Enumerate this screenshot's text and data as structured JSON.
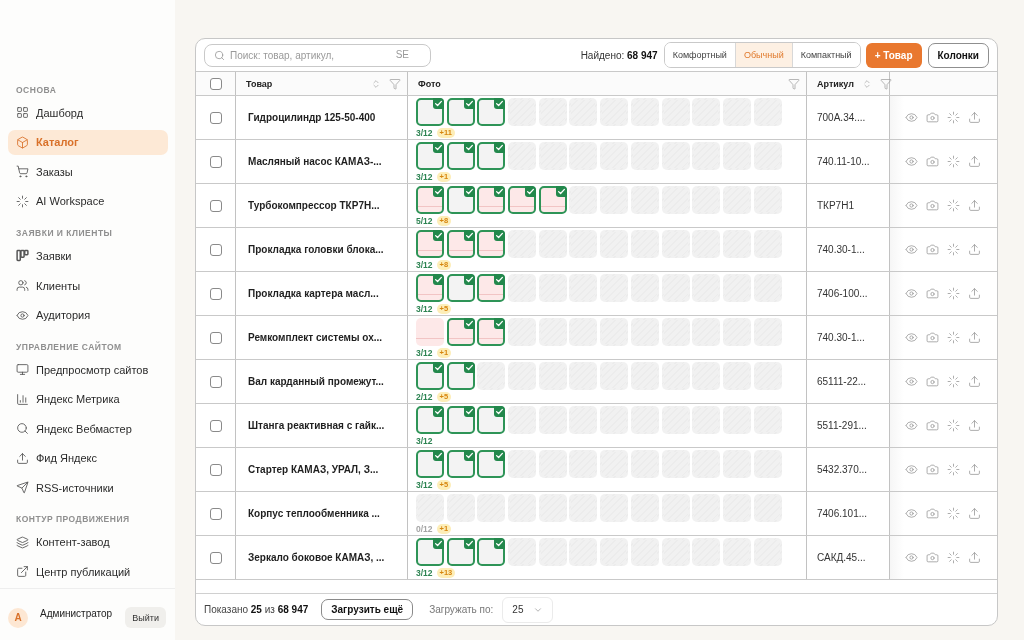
{
  "sidebar": {
    "sections": [
      {
        "label": "ОСНОВА",
        "items": [
          {
            "label": "Дашборд",
            "selected": false
          },
          {
            "label": "Каталог",
            "selected": true
          },
          {
            "label": "Заказы",
            "selected": false
          },
          {
            "label": "AI Workspace",
            "selected": false
          }
        ]
      },
      {
        "label": "ЗАЯВКИ И КЛИЕНТЫ",
        "items": [
          {
            "label": "Заявки",
            "selected": false
          },
          {
            "label": "Клиенты",
            "selected": false
          },
          {
            "label": "Аудитория",
            "selected": false
          }
        ]
      },
      {
        "label": "УПРАВЛЕНИЕ САЙТОМ",
        "items": [
          {
            "label": "Предпросмотр сайтов",
            "selected": false
          },
          {
            "label": "Яндекс Метрика",
            "selected": false
          },
          {
            "label": "Яндекс Вебмастер",
            "selected": false
          },
          {
            "label": "Фид Яндекс",
            "selected": false
          },
          {
            "label": "RSS-источники",
            "selected": false
          }
        ]
      },
      {
        "label": "КОНТУР ПРОДВИЖЕНИЯ",
        "items": [
          {
            "label": "Контент-завод",
            "selected": false
          },
          {
            "label": "Центр публикаций",
            "selected": false
          }
        ]
      }
    ],
    "user": {
      "initial": "А",
      "name": "Администратор",
      "logout": "Выйти"
    }
  },
  "toolbar": {
    "search": {
      "placeholder": "Поиск: товар, артикул,",
      "suffix": "SE"
    },
    "found": "Найдено: **68 947**",
    "density": [
      {
        "label": "Комфортный",
        "selected": false
      },
      {
        "label": "Обычный",
        "selected": true
      },
      {
        "label": "Компактный",
        "selected": false
      }
    ],
    "add_button": "+ Товар",
    "columns_button": "Колонки"
  },
  "table": {
    "header_checkbox": {
      "checked": false
    },
    "columns": [
      {
        "label": "Товар",
        "sortable": true,
        "filterable": true
      },
      {
        "label": "Фото",
        "sortable": false,
        "filterable": true
      },
      {
        "label": "Артикул",
        "sortable": true,
        "filterable": true
      }
    ],
    "rows": [
      {
        "selected": false,
        "name": "Гидроцилиндр 125-50-400",
        "photos": [
          {
            "kind": "photo",
            "checked": true
          },
          {
            "kind": "photo",
            "checked": true
          },
          {
            "kind": "photo",
            "checked": true
          },
          {
            "kind": "empty",
            "checked": false
          },
          {
            "kind": "empty",
            "checked": false
          },
          {
            "kind": "empty",
            "checked": false
          },
          {
            "kind": "empty",
            "checked": false
          },
          {
            "kind": "empty",
            "checked": false
          },
          {
            "kind": "empty",
            "checked": false
          },
          {
            "kind": "empty",
            "checked": false
          },
          {
            "kind": "empty",
            "checked": false
          },
          {
            "kind": "empty",
            "checked": false
          }
        ],
        "count": "3/12",
        "extra": "+11",
        "article": "700A.34...."
      },
      {
        "selected": false,
        "name": "Масляный насос КАМАЗ-...",
        "photos": [
          {
            "kind": "photo",
            "checked": true
          },
          {
            "kind": "photo",
            "checked": true
          },
          {
            "kind": "photo",
            "checked": true
          },
          {
            "kind": "empty",
            "checked": false
          },
          {
            "kind": "empty",
            "checked": false
          },
          {
            "kind": "empty",
            "checked": false
          },
          {
            "kind": "empty",
            "checked": false
          },
          {
            "kind": "empty",
            "checked": false
          },
          {
            "kind": "empty",
            "checked": false
          },
          {
            "kind": "empty",
            "checked": false
          },
          {
            "kind": "empty",
            "checked": false
          },
          {
            "kind": "empty",
            "checked": false
          }
        ],
        "count": "3/12",
        "extra": "+1",
        "article": "740.11-10..."
      },
      {
        "selected": false,
        "name": "Турбокомпрессор ТКР7Н...",
        "photos": [
          {
            "kind": "flagged",
            "checked": true
          },
          {
            "kind": "photo",
            "checked": true
          },
          {
            "kind": "flagged",
            "checked": true
          },
          {
            "kind": "flagged",
            "checked": true
          },
          {
            "kind": "flagged",
            "checked": true
          },
          {
            "kind": "empty",
            "checked": false
          },
          {
            "kind": "empty",
            "checked": false
          },
          {
            "kind": "empty",
            "checked": false
          },
          {
            "kind": "empty",
            "checked": false
          },
          {
            "kind": "empty",
            "checked": false
          },
          {
            "kind": "empty",
            "checked": false
          },
          {
            "kind": "empty",
            "checked": false
          }
        ],
        "count": "5/12",
        "extra": "+8",
        "article": "ТКР7Н1"
      },
      {
        "selected": false,
        "name": "Прокладка головки блока...",
        "photos": [
          {
            "kind": "flagged",
            "checked": true
          },
          {
            "kind": "flagged",
            "checked": true
          },
          {
            "kind": "flagged",
            "checked": true
          },
          {
            "kind": "empty",
            "checked": false
          },
          {
            "kind": "empty",
            "checked": false
          },
          {
            "kind": "empty",
            "checked": false
          },
          {
            "kind": "empty",
            "checked": false
          },
          {
            "kind": "empty",
            "checked": false
          },
          {
            "kind": "empty",
            "checked": false
          },
          {
            "kind": "empty",
            "checked": false
          },
          {
            "kind": "empty",
            "checked": false
          },
          {
            "kind": "empty",
            "checked": false
          }
        ],
        "count": "3/12",
        "extra": "+8",
        "article": "740.30-1..."
      },
      {
        "selected": false,
        "name": "Прокладка картера масл...",
        "photos": [
          {
            "kind": "flagged",
            "checked": true
          },
          {
            "kind": "photo",
            "checked": true
          },
          {
            "kind": "flagged",
            "checked": true
          },
          {
            "kind": "empty",
            "checked": false
          },
          {
            "kind": "empty",
            "checked": false
          },
          {
            "kind": "empty",
            "checked": false
          },
          {
            "kind": "empty",
            "checked": false
          },
          {
            "kind": "empty",
            "checked": false
          },
          {
            "kind": "empty",
            "checked": false
          },
          {
            "kind": "empty",
            "checked": false
          },
          {
            "kind": "empty",
            "checked": false
          },
          {
            "kind": "empty",
            "checked": false
          }
        ],
        "count": "3/12",
        "extra": "+5",
        "article": "7406-100..."
      },
      {
        "selected": false,
        "name": "Ремкомплект системы ох...",
        "photos": [
          {
            "kind": "flagged",
            "checked": false
          },
          {
            "kind": "flagged",
            "checked": true
          },
          {
            "kind": "flagged",
            "checked": true
          },
          {
            "kind": "empty",
            "checked": false
          },
          {
            "kind": "empty",
            "checked": false
          },
          {
            "kind": "empty",
            "checked": false
          },
          {
            "kind": "empty",
            "checked": false
          },
          {
            "kind": "empty",
            "checked": false
          },
          {
            "kind": "empty",
            "checked": false
          },
          {
            "kind": "empty",
            "checked": false
          },
          {
            "kind": "empty",
            "checked": false
          },
          {
            "kind": "empty",
            "checked": false
          }
        ],
        "count": "3/12",
        "extra": "+1",
        "article": "740.30-1..."
      },
      {
        "selected": false,
        "name": "Вал карданный промежут...",
        "photos": [
          {
            "kind": "photo",
            "checked": true
          },
          {
            "kind": "photo",
            "checked": true
          },
          {
            "kind": "empty",
            "checked": false
          },
          {
            "kind": "empty",
            "checked": false
          },
          {
            "kind": "empty",
            "checked": false
          },
          {
            "kind": "empty",
            "checked": false
          },
          {
            "kind": "empty",
            "checked": false
          },
          {
            "kind": "empty",
            "checked": false
          },
          {
            "kind": "empty",
            "checked": false
          },
          {
            "kind": "empty",
            "checked": false
          },
          {
            "kind": "empty",
            "checked": false
          },
          {
            "kind": "empty",
            "checked": false
          }
        ],
        "count": "2/12",
        "extra": "+5",
        "article": "65111-22..."
      },
      {
        "selected": false,
        "name": "Штанга реактивная с гайк...",
        "photos": [
          {
            "kind": "photo",
            "checked": true
          },
          {
            "kind": "photo",
            "checked": true
          },
          {
            "kind": "photo",
            "checked": true
          },
          {
            "kind": "empty",
            "checked": false
          },
          {
            "kind": "empty",
            "checked": false
          },
          {
            "kind": "empty",
            "checked": false
          },
          {
            "kind": "empty",
            "checked": false
          },
          {
            "kind": "empty",
            "checked": false
          },
          {
            "kind": "empty",
            "checked": false
          },
          {
            "kind": "empty",
            "checked": false
          },
          {
            "kind": "empty",
            "checked": false
          },
          {
            "kind": "empty",
            "checked": false
          }
        ],
        "count": "3/12",
        "article": "5511-291..."
      },
      {
        "selected": false,
        "name": "Стартер КАМАЗ, УРАЛ, З...",
        "photos": [
          {
            "kind": "photo",
            "checked": true
          },
          {
            "kind": "photo",
            "checked": true
          },
          {
            "kind": "photo",
            "checked": true
          },
          {
            "kind": "empty",
            "checked": false
          },
          {
            "kind": "empty",
            "checked": false
          },
          {
            "kind": "empty",
            "checked": false
          },
          {
            "kind": "empty",
            "checked": false
          },
          {
            "kind": "empty",
            "checked": false
          },
          {
            "kind": "empty",
            "checked": false
          },
          {
            "kind": "empty",
            "checked": false
          },
          {
            "kind": "empty",
            "checked": false
          },
          {
            "kind": "empty",
            "checked": false
          }
        ],
        "count": "3/12",
        "extra": "+5",
        "article": "5432.370..."
      },
      {
        "selected": false,
        "name": "Корпус теплообменника ...",
        "photos": [
          {
            "kind": "empty",
            "checked": false
          },
          {
            "kind": "empty",
            "checked": false
          },
          {
            "kind": "empty",
            "checked": false
          },
          {
            "kind": "empty",
            "checked": false
          },
          {
            "kind": "empty",
            "checked": false
          },
          {
            "kind": "empty",
            "checked": false
          },
          {
            "kind": "empty",
            "checked": false
          },
          {
            "kind": "empty",
            "checked": false
          },
          {
            "kind": "empty",
            "checked": false
          },
          {
            "kind": "empty",
            "checked": false
          },
          {
            "kind": "empty",
            "checked": false
          },
          {
            "kind": "empty",
            "checked": false
          }
        ],
        "count": "0/12",
        "extra": "+1",
        "article": "7406.101..."
      },
      {
        "selected": false,
        "name": "Зеркало боковое КАМАЗ, ...",
        "photos": [
          {
            "kind": "photo",
            "checked": true
          },
          {
            "kind": "photo",
            "checked": true
          },
          {
            "kind": "photo",
            "checked": true
          },
          {
            "kind": "empty",
            "checked": false
          },
          {
            "kind": "empty",
            "checked": false
          },
          {
            "kind": "empty",
            "checked": false
          },
          {
            "kind": "empty",
            "checked": false
          },
          {
            "kind": "empty",
            "checked": false
          },
          {
            "kind": "empty",
            "checked": false
          },
          {
            "kind": "empty",
            "checked": false
          },
          {
            "kind": "empty",
            "checked": false
          },
          {
            "kind": "empty",
            "checked": false
          }
        ],
        "count": "3/12",
        "extra": "+13",
        "article": "САКД.45..."
      }
    ]
  },
  "footer": {
    "shown": "Показано **25** из **68 947**",
    "load_more": "Загрузить ещё",
    "page_size_label": "Загружать по:",
    "page_size": "25"
  }
}
